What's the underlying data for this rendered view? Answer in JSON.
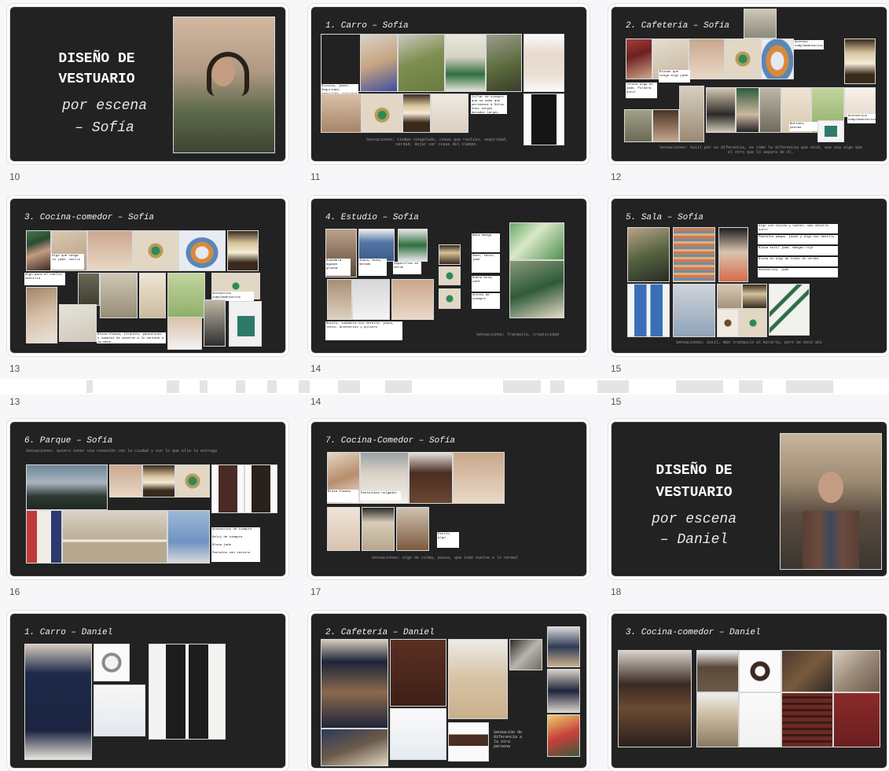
{
  "colors": {
    "slide_bg": "#222222",
    "page_bg": "#f7f7f9",
    "slide_number": "#555555",
    "text_box": "#ffffff"
  },
  "slides": {
    "s10": {
      "number": "10",
      "title_line1": "DISEÑO DE",
      "title_line2": "VESTUARIO",
      "sub_line1": "por escena",
      "sub_line2": "– Sofía"
    },
    "s11": {
      "number": "11",
      "title": "1. Carro – Sofía",
      "notes": [
        "Blusita, jeans. Seguridad, sencillez, sutileza",
        "Collar de siempre que se sabe que pertenece a Sofía. Unos largos dorados largos jade",
        "Sensaciones: tiempo congelado, cosas que realizo, seguridad, verdad, dejar ver cosas del tiempo."
      ]
    },
    "s12": {
      "number": "12",
      "title": "2. Cafetería – Sofía",
      "notes": [
        "Accesos complementarios",
        "Blusas que tenga algo jade",
        "Tirale algo en jade. Pulsera sutil",
        "Botines, pescas",
        "Accesorios complementarios",
        "Sensaciones: Sutil por su diferencia, es cómo la diferencia que está, que usa algo que el otro que lo separa de él."
      ]
    },
    "s13": {
      "number": "13",
      "title": "3. Cocina-comedor – Sofía",
      "notes": [
        "Algo que tenga la jade, cuello",
        "Algo para el cuello, sencilla",
        "Accesorios complementarios",
        "Blusa blanca, tirantes, pantalones y zapatos de acuerdo a lo sentado a la mesa"
      ]
    },
    "s14": {
      "number": "14",
      "title": "4. Estudio – Sofía",
      "notes": [
        "Sudadera aguayo gruesa",
        "Jeans, bota, morado",
        "Zapatillas en verde",
        "Bata manga",
        "Bueno bota, café",
        "Aretes de siempre",
        "Saco, tenis, jade",
        "Sensaciones: Tranquilo, creatividad",
        "Bonito, sudadera con detalle, jeans, tenis, accesorios y pulsera"
      ]
    },
    "s15": {
      "number": "15",
      "title": "5. Sala – Sofía",
      "notes": [
        "Algo con tejido y suéter, mas detalle sutil",
        "Pantalón pampa, jeans y algo con detalle",
        "Blusa sutil jade, mangas rojo",
        "Blusa en algo de tonos de verdes",
        "Accesorios, jade",
        "Sensaciones: Sutil, más tranquilo al mirarla, pero se está ahí"
      ]
    },
    "s16": {
      "number": "16",
      "title": "6. Parque – Sofía",
      "notes": [
        "Sensaciones: quiero tener una conexión con la ciudad y con lo que ella le entrega",
        "Accesorios de siempre",
        "Reloj de siempre",
        "Blusa jade",
        "Pantalón con textura"
      ]
    },
    "s17": {
      "number": "17",
      "title": "7. Cocina-Comedor – Sofía",
      "notes": [
        "Blusa blanca",
        "Pantalones holgados",
        "Botines",
        "Estilo, algo",
        "Sensaciones: algo de calma, pausa, que todo vuelve a lo normal"
      ]
    },
    "s18": {
      "number": "18",
      "title_line1": "DISEÑO DE",
      "title_line2": "VESTUARIO",
      "sub_line1": "por escena",
      "sub_line2": "– Daniel"
    },
    "s19": {
      "number": "",
      "title": "1. Carro – Daniel"
    },
    "s20": {
      "number": "",
      "title": "2. Cafetería – Daniel",
      "notes": [
        "Sensación de diferencia a la otra persona"
      ]
    },
    "s21": {
      "number": "",
      "title": "3. Cocina-comedor – Daniel"
    }
  },
  "repeat_labels": {
    "a": "13",
    "b": "14",
    "c": "15"
  }
}
